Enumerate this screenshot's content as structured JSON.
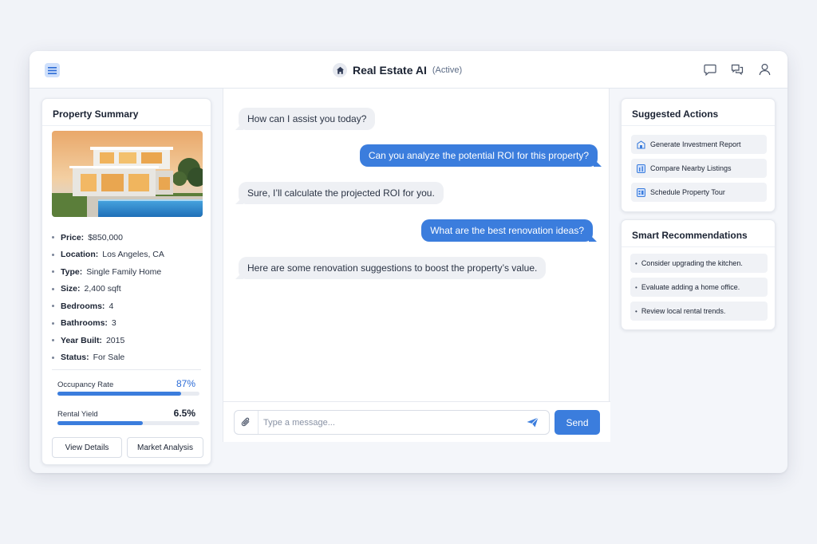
{
  "header": {
    "title": "Real Estate AI",
    "status": "(Active)"
  },
  "property": {
    "panel_title": "Property Summary",
    "details": [
      {
        "label": "Price:",
        "value": "$850,000"
      },
      {
        "label": "Location:",
        "value": "Los Angeles, CA"
      },
      {
        "label": "Type:",
        "value": "Single Family Home"
      },
      {
        "label": "Size:",
        "value": "2,400 sqft"
      },
      {
        "label": "Bedrooms:",
        "value": "4"
      },
      {
        "label": "Bathrooms:",
        "value": "3"
      },
      {
        "label": "Year Built:",
        "value": "2015"
      },
      {
        "label": "Status:",
        "value": "For Sale"
      }
    ],
    "metrics": [
      {
        "label": "Occupancy Rate",
        "value": "87%",
        "fraction": 0.87
      },
      {
        "label": "Rental Yield",
        "value": "6.5%",
        "fraction": 0.6
      }
    ],
    "view_details_label": "View Details",
    "market_analysis_label": "Market Analysis"
  },
  "chat": {
    "messages": [
      {
        "role": "assistant",
        "text": "How can I assist you today?"
      },
      {
        "role": "user",
        "text": "Can you analyze the potential ROI for this property?"
      },
      {
        "role": "assistant",
        "text": "Sure, I’ll calculate the projected ROI for you."
      },
      {
        "role": "user",
        "text": "What are the best renovation ideas?"
      },
      {
        "role": "assistant",
        "text": "Here are some renovation suggestions to boost the property’s value."
      }
    ],
    "input_value": "",
    "input_placeholder": "Type a message...",
    "send_label": "Send"
  },
  "suggested_actions": {
    "title": "Suggested Actions",
    "items": [
      {
        "label": "Generate Investment Report",
        "icon": "building-icon"
      },
      {
        "label": "Compare Nearby Listings",
        "icon": "compare-icon"
      },
      {
        "label": "Schedule Property Tour",
        "icon": "calendar-icon"
      }
    ]
  },
  "smart_recommendations": {
    "title": "Smart Recommendations",
    "items": [
      "Consider upgrading the kitchen.",
      "Evaluate adding a home office.",
      "Review local rental trends."
    ]
  },
  "colors": {
    "accent": "#3b7ddd",
    "background": "#f1f3f8"
  }
}
